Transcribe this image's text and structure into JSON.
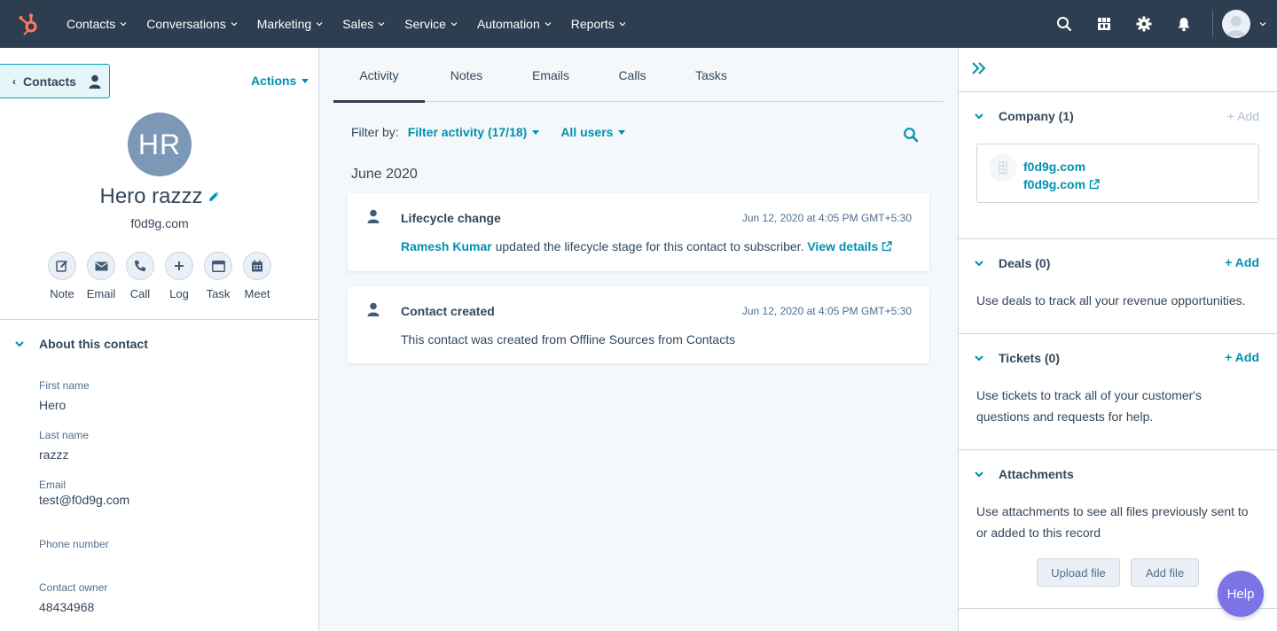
{
  "nav": {
    "items": [
      {
        "label": "Contacts"
      },
      {
        "label": "Conversations"
      },
      {
        "label": "Marketing"
      },
      {
        "label": "Sales"
      },
      {
        "label": "Service"
      },
      {
        "label": "Automation"
      },
      {
        "label": "Reports"
      }
    ],
    "icons": [
      "search-icon",
      "marketplace-icon",
      "settings-icon",
      "notifications-icon"
    ]
  },
  "left": {
    "back_label": "Contacts",
    "actions_label": "Actions",
    "avatar_initials": "HR",
    "name": "Hero razzz",
    "domain": "f0d9g.com",
    "quick_actions": [
      {
        "label": "Note",
        "icon": "note-icon"
      },
      {
        "label": "Email",
        "icon": "email-icon"
      },
      {
        "label": "Call",
        "icon": "call-icon"
      },
      {
        "label": "Log",
        "icon": "log-icon"
      },
      {
        "label": "Task",
        "icon": "task-icon"
      },
      {
        "label": "Meet",
        "icon": "meet-icon"
      }
    ],
    "about_title": "About this contact",
    "properties": [
      {
        "label": "First name",
        "value": "Hero"
      },
      {
        "label": "Last name",
        "value": "razzz"
      },
      {
        "label": "Email",
        "value": "test@f0d9g.com"
      },
      {
        "label": "Phone number",
        "value": ""
      },
      {
        "label": "Contact owner",
        "value": "48434968"
      }
    ]
  },
  "middle": {
    "tabs": [
      {
        "label": "Activity"
      },
      {
        "label": "Notes"
      },
      {
        "label": "Emails"
      },
      {
        "label": "Calls"
      },
      {
        "label": "Tasks"
      }
    ],
    "filter_label": "Filter by:",
    "filter_activity": "Filter activity (17/18)",
    "filter_users": "All users",
    "month": "June 2020",
    "activities": [
      {
        "title": "Lifecycle change",
        "time": "Jun 12, 2020 at 4:05 PM GMT+5:30",
        "actor": "Ramesh Kumar",
        "text": " updated the lifecycle stage for this contact to subscriber. ",
        "link": "View details"
      },
      {
        "title": "Contact created",
        "time": "Jun 12, 2020 at 4:05 PM GMT+5:30",
        "text": "This contact was created from Offline Sources from Contacts"
      }
    ]
  },
  "right": {
    "company": {
      "title": "Company (1)",
      "add": "+ Add",
      "name": "f0d9g.com",
      "domain": "f0d9g.com"
    },
    "deals": {
      "title": "Deals (0)",
      "add": "+ Add",
      "text": "Use deals to track all your revenue opportunities."
    },
    "tickets": {
      "title": "Tickets (0)",
      "add": "+ Add",
      "text": "Use tickets to track all of your customer's questions and requests for help."
    },
    "attachments": {
      "title": "Attachments",
      "text": "Use attachments to see all files previously sent to or added to this record",
      "upload": "Upload file",
      "add_file": "Add file"
    }
  },
  "help_label": "Help",
  "colors": {
    "nav_bg": "#2d3e50",
    "accent": "#0091ae",
    "hubspot_orange": "#ff7a59"
  }
}
